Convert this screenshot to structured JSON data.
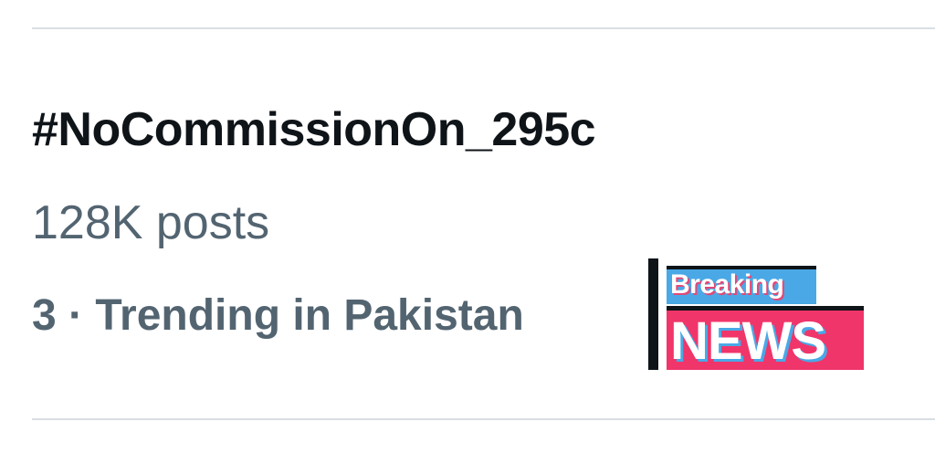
{
  "trend": {
    "hashtag": "#NoCommissionOn_295c",
    "post_count": "128K posts",
    "context": "3 · Trending in Pakistan"
  },
  "badge": {
    "top_text": "Breaking",
    "bottom_text": "NEWS",
    "colors": {
      "top": "#4aa8e6",
      "bottom": "#f0356a",
      "bar": "#0f1419"
    }
  },
  "colors": {
    "primary_text": "#0f1419",
    "secondary_text": "#536471",
    "divider": "#d9dee3"
  }
}
